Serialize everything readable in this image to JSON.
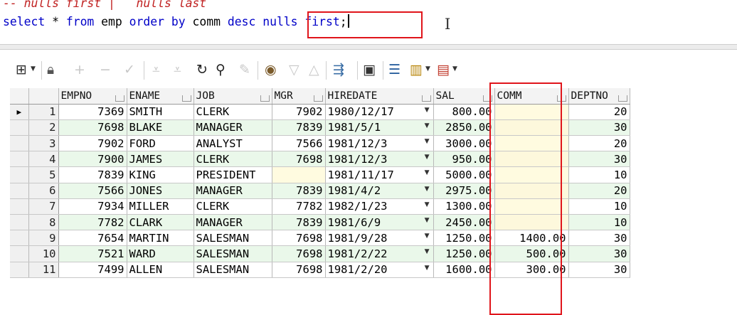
{
  "editor": {
    "comment": "-- nulls first |   nulls last",
    "sql": {
      "kw_select": "select",
      "star": " * ",
      "kw_from": "from",
      "table": " emp ",
      "kw_order": "order",
      "sp1": " ",
      "kw_by": "by",
      "col": " comm ",
      "kw_desc": "desc",
      "sp2": " ",
      "kw_nulls": "nulls",
      "sp3": " ",
      "kw_first": "first",
      "semi": ";"
    }
  },
  "toolbar": {
    "icons": [
      "grid-icon",
      "lock-icon",
      "add-icon",
      "remove-icon",
      "post-icon",
      "filter-icon",
      "filter-clear-icon",
      "refresh-icon",
      "find-icon",
      "clear-icon",
      "query-icon",
      "sort-desc-icon",
      "sort-asc-icon",
      "wizard-icon",
      "save-icon",
      "export-icon",
      "chart-icon",
      "report-icon"
    ]
  },
  "grid": {
    "columns": [
      "EMPNO",
      "ENAME",
      "JOB",
      "MGR",
      "HIREDATE",
      "SAL",
      "COMM",
      "DEPTNO"
    ],
    "rows": [
      {
        "n": "1",
        "empno": "7369",
        "ename": "SMITH",
        "job": "CLERK",
        "mgr": "7902",
        "hiredate": "1980/12/17",
        "sal": "800.00",
        "comm": "",
        "deptno": "20"
      },
      {
        "n": "2",
        "empno": "7698",
        "ename": "BLAKE",
        "job": "MANAGER",
        "mgr": "7839",
        "hiredate": "1981/5/1",
        "sal": "2850.00",
        "comm": "",
        "deptno": "30"
      },
      {
        "n": "3",
        "empno": "7902",
        "ename": "FORD",
        "job": "ANALYST",
        "mgr": "7566",
        "hiredate": "1981/12/3",
        "sal": "3000.00",
        "comm": "",
        "deptno": "20"
      },
      {
        "n": "4",
        "empno": "7900",
        "ename": "JAMES",
        "job": "CLERK",
        "mgr": "7698",
        "hiredate": "1981/12/3",
        "sal": "950.00",
        "comm": "",
        "deptno": "30"
      },
      {
        "n": "5",
        "empno": "7839",
        "ename": "KING",
        "job": "PRESIDENT",
        "mgr": "",
        "hiredate": "1981/11/17",
        "sal": "5000.00",
        "comm": "",
        "deptno": "10"
      },
      {
        "n": "6",
        "empno": "7566",
        "ename": "JONES",
        "job": "MANAGER",
        "mgr": "7839",
        "hiredate": "1981/4/2",
        "sal": "2975.00",
        "comm": "",
        "deptno": "20"
      },
      {
        "n": "7",
        "empno": "7934",
        "ename": "MILLER",
        "job": "CLERK",
        "mgr": "7782",
        "hiredate": "1982/1/23",
        "sal": "1300.00",
        "comm": "",
        "deptno": "10"
      },
      {
        "n": "8",
        "empno": "7782",
        "ename": "CLARK",
        "job": "MANAGER",
        "mgr": "7839",
        "hiredate": "1981/6/9",
        "sal": "2450.00",
        "comm": "",
        "deptno": "10"
      },
      {
        "n": "9",
        "empno": "7654",
        "ename": "MARTIN",
        "job": "SALESMAN",
        "mgr": "7698",
        "hiredate": "1981/9/28",
        "sal": "1250.00",
        "comm": "1400.00",
        "deptno": "30"
      },
      {
        "n": "10",
        "empno": "7521",
        "ename": "WARD",
        "job": "SALESMAN",
        "mgr": "7698",
        "hiredate": "1981/2/22",
        "sal": "1250.00",
        "comm": "500.00",
        "deptno": "30"
      },
      {
        "n": "11",
        "empno": "7499",
        "ename": "ALLEN",
        "job": "SALESMAN",
        "mgr": "7698",
        "hiredate": "1981/2/20",
        "sal": "1600.00",
        "comm": "300.00",
        "deptno": "30"
      }
    ]
  },
  "colors": {
    "highlight": "#e0151b",
    "keyword": "#0000c8",
    "comment": "#c02020",
    "even_row": "#eaf8ea",
    "null_cell": "#fffbe0"
  }
}
